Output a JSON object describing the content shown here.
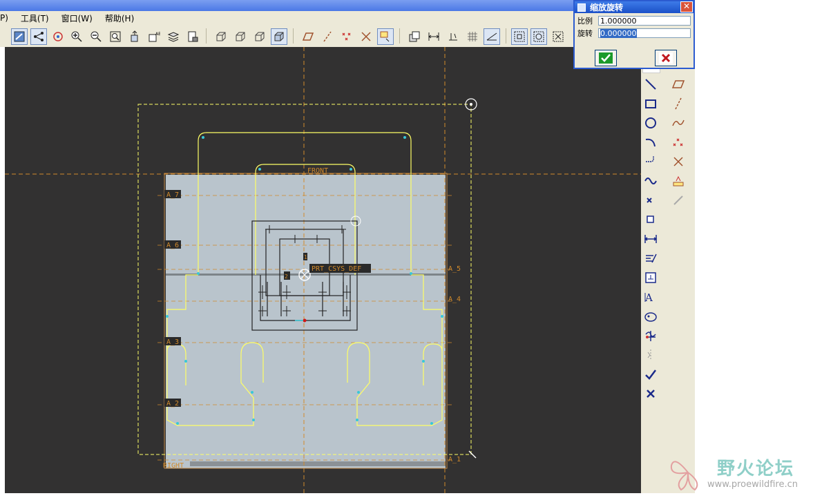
{
  "menu": {
    "items": [
      "P)",
      "工具(T)",
      "窗口(W)",
      "帮助(H)"
    ]
  },
  "toolbar": {
    "icons": [
      "repaint-icon",
      "datum-display-icon",
      "spin-center-icon",
      "zoom-in-icon",
      "zoom-out-icon",
      "refit-icon",
      "saved-view-icon",
      "view-manager-icon",
      "layers-icon",
      "model-tree-icon",
      "wireframe-icon",
      "hidden-line-icon",
      "no-hidden-icon",
      "shaded-icon",
      "datum-plane-icon",
      "datum-axis-icon",
      "datum-point-icon",
      "csys-icon",
      "sketcher-display-icon",
      "section-icon",
      "dimension-display-icon",
      "constraint-display-icon",
      "grid-display-icon",
      "vertex-display-icon",
      "sketch-orient-icon",
      "select-all-icon",
      "deselect-icon"
    ]
  },
  "dialog": {
    "title": "缩放旋转",
    "scale_label": "比例",
    "scale_value": "1.000000",
    "rotate_label": "旋转",
    "rotate_value": "0.000000",
    "ok_icon": "checkmark-icon",
    "cancel_icon": "x-icon",
    "colors": {
      "ok": "#1a9a2a",
      "cancel": "#c0171d"
    }
  },
  "sketch": {
    "labels": {
      "front": "FRONT",
      "right": "RIGHT",
      "csys": "PRT_CSYS_DEF",
      "a7": "A_7",
      "a6": "A_6",
      "a5": "A_5",
      "a4": "A_4",
      "a3": "A_3",
      "a2": "A_2",
      "a1": "A_1",
      "dim_1": "1",
      "dim_2": "2"
    },
    "colors": {
      "background": "#323131",
      "part": "#b9c4cc",
      "outline": "#ffff66",
      "datum": "#d28a2a"
    }
  },
  "right_toolbar": {
    "icons": [
      "line-icon",
      "parallelogram-icon",
      "rectangle-icon",
      "centerline-icon",
      "circle-icon",
      "spline-icon",
      "arc-icon",
      "points-icon",
      "fillet-icon",
      "csys-point-icon",
      "trim-icon",
      "palette-icon",
      "chamfer-icon",
      "dynamic-trim-icon",
      "offset-icon",
      "dimension-icon",
      "modify-icon",
      "constraint-icon",
      "text-icon",
      "palette-shape-icon",
      "divide-icon",
      "mirror-icon",
      "done-checkmark-icon",
      "quit-x-icon"
    ]
  },
  "watermark": {
    "title": "野火论坛",
    "url": "www.proewildfire.cn"
  }
}
